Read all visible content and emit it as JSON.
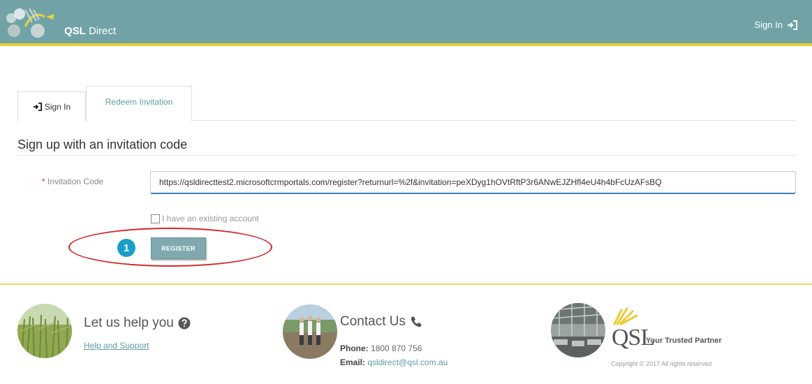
{
  "header": {
    "brand_bold": "QSL",
    "brand_rest": " Direct",
    "signin_label": "Sign In"
  },
  "tabs": [
    {
      "label": "Sign In"
    },
    {
      "label": "Redeem Invitation"
    }
  ],
  "form": {
    "title": "Sign up with an invitation code",
    "invitation_label": "Invitation Code",
    "required_marker": "*",
    "invitation_value": "https://qsldirecttest2.microsoftcrmportals.com/register?returnurl=%2f&invitation=peXDyg1hOVtRftP3r6ANwEJZHfl4eU4h4bFcUzAFsBQ",
    "existing_account_label": "I have an existing account",
    "register_label": "REGISTER",
    "callout_number": "1"
  },
  "footer": {
    "help_title": "Let us help you",
    "help_link": "Help and Support",
    "contact_title": "Contact Us",
    "phone_label": "Phone:",
    "phone_value": "1800 870 756",
    "email_label": "Email:",
    "email_value": "qsldirect@qsl.com.au",
    "logo_text": "QSL",
    "tagline": "Your Trusted Partner",
    "copyright": "Copyright © 2017  All rights reserved"
  },
  "colors": {
    "header_bg": "#71a3a6",
    "accent_yellow": "#e8cf2d",
    "link_teal": "#5c9aa0",
    "callout_red": "#d3262a",
    "badge_blue": "#1a9ec9"
  },
  "icons": {
    "signin": "sign-in-icon",
    "help": "question-circle-icon",
    "phone": "phone-icon"
  }
}
